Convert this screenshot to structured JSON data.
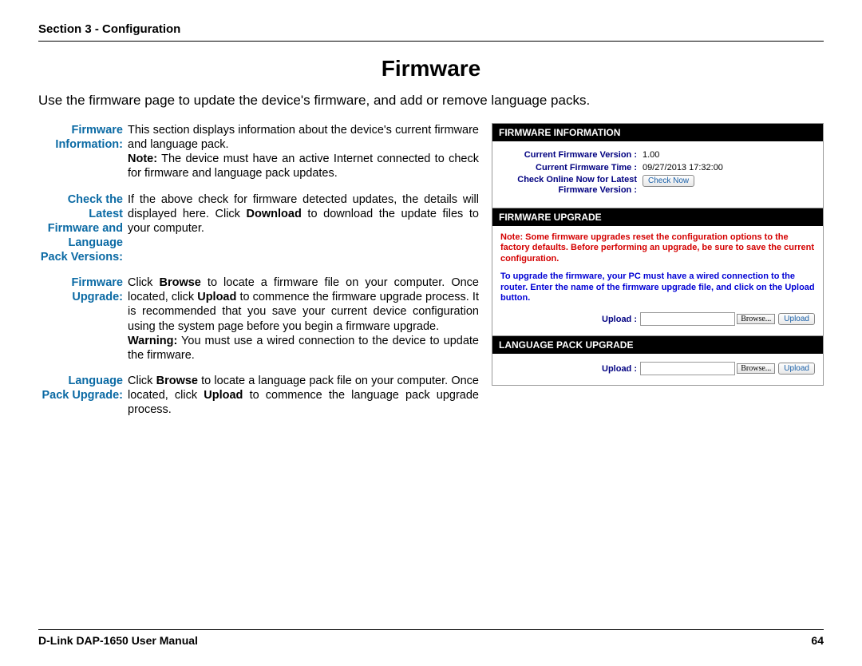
{
  "header": {
    "section": "Section 3 - Configuration"
  },
  "title": "Firmware",
  "intro": "Use the firmware page to update the device's firmware, and add or remove language packs.",
  "defs": [
    {
      "term": "Firmware Information:",
      "body": "This section displays information about the device's current firmware and language pack.",
      "note_label": "Note:",
      "note": " The device must have an active Internet connected to check for firmware and language pack updates."
    },
    {
      "term": "Check the Latest Firmware and Language Pack Versions:",
      "body_pre": "If the above check for firmware detected updates, the details will displayed here. Click ",
      "bold1": "Download",
      "body_post": " to download the update files to your computer."
    },
    {
      "term": "Firmware Upgrade:",
      "body_pre": "Click ",
      "bold1": "Browse",
      "body_mid": " to locate a firmware file on your computer. Once located, click ",
      "bold2": "Upload",
      "body_post": " to commence the firmware upgrade process. It is recommended that you save your current device configuration using the system page before you begin a firmware upgrade.",
      "warn_label": "Warning:",
      "warn": " You must use a wired connection to the device to update the firmware."
    },
    {
      "term": "Language Pack Upgrade:",
      "body_pre": "Click ",
      "bold1": "Browse",
      "body_mid": " to locate a language pack file on your computer. Once located, click ",
      "bold2": "Upload",
      "body_post": " to commence the language pack upgrade process."
    }
  ],
  "panel": {
    "s1": {
      "title": "FIRMWARE INFORMATION",
      "rows": [
        {
          "label": "Current Firmware Version  :",
          "value": "1.00"
        },
        {
          "label": "Current Firmware Time  :",
          "value": "09/27/2013 17:32:00"
        }
      ],
      "checkrow": {
        "label": "Check Online Now for Latest Firmware Version",
        "colon": "  :",
        "btn": "Check Now"
      }
    },
    "s2": {
      "title": "FIRMWARE UPGRADE",
      "red": "Note: Some firmware upgrades reset the configuration options to the factory defaults. Before performing an upgrade, be sure to save the current configuration.",
      "blue": "To upgrade the firmware, your PC must have a wired connection to the router. Enter the name of the firmware upgrade file, and click on the Upload button.",
      "upload_label": "Upload  :",
      "browse": "Browse...",
      "upload_btn": "Upload"
    },
    "s3": {
      "title": "LANGUAGE PACK UPGRADE",
      "upload_label": "Upload  :",
      "browse": "Browse...",
      "upload_btn": "Upload"
    }
  },
  "footer": {
    "manual": "D-Link DAP-1650 User Manual",
    "page": "64"
  }
}
